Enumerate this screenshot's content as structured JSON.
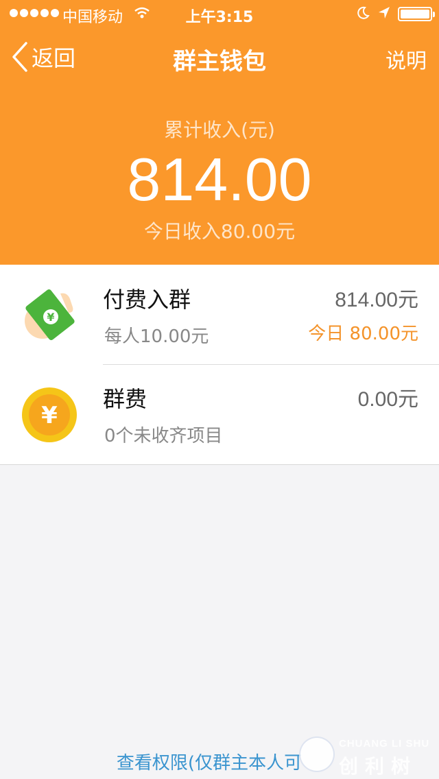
{
  "status_bar": {
    "carrier": "中国移动",
    "time": "上午3:15"
  },
  "nav": {
    "back_label": "返回",
    "title": "群主钱包",
    "right_label": "说明"
  },
  "earnings": {
    "label": "累计收入(元)",
    "amount": "814.00",
    "today": "今日收入80.00元"
  },
  "list": {
    "items": [
      {
        "title": "付费入群",
        "subtitle": "每人10.00元",
        "amount": "814.00元",
        "today": "今日 80.00元",
        "icon": "money-hand-icon"
      },
      {
        "title": "群费",
        "subtitle": "0个未收齐项目",
        "amount": "0.00元",
        "icon": "yen-coin-icon"
      }
    ]
  },
  "footer": {
    "link": "查看权限(仅群主本人可"
  },
  "watermark": {
    "en": "CHUANG LI SHU",
    "cn": "创利树"
  },
  "colors": {
    "header_orange": "#fb982b",
    "accent_orange": "#f4932a",
    "link_blue": "#3a94cf",
    "coin_yellow": "#f5c518"
  }
}
